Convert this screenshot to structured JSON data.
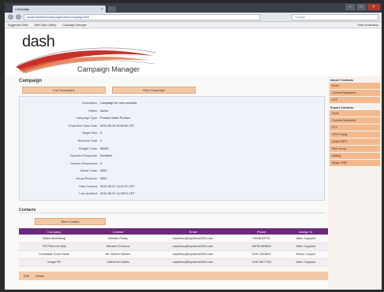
{
  "browser": {
    "tab_title": "Campaign",
    "url": "localhost/dash/campaign/view/campaign/id/4",
    "search_placeholder": "Google",
    "bookmarks": [
      "Suggested Sites",
      "Web Slice Gallery",
      "Campaign Manager"
    ],
    "other_bookmarks": "Other bookmarks"
  },
  "header": {
    "logo_word": "dash",
    "app_title": "Campaign Manager"
  },
  "page": {
    "title": "Campaign",
    "buttons": {
      "list": "List Campaigns",
      "view": "View Campaign"
    },
    "details": [
      {
        "label": "Description:",
        "value": "Campaign for new products"
      },
      {
        "label": "Status:",
        "value": "Active"
      },
      {
        "label": "Campaign Type:",
        "value": "Product Sales Product"
      },
      {
        "label": "Expected Close Date:",
        "value": "2012-05-15 00:00:00 CET"
      },
      {
        "label": "Target Size:",
        "value": "0"
      },
      {
        "label": "Revenue Goal:",
        "value": "0"
      },
      {
        "label": "Budget Costs:",
        "value": "50000"
      },
      {
        "label": "Expected Response:",
        "value": "Excellent"
      },
      {
        "label": "Number Responses:",
        "value": "0"
      },
      {
        "label": "Actual Costs:",
        "value": "5000"
      },
      {
        "label": "Actual Revenue:",
        "value": "5000"
      },
      {
        "label": "Date Created:",
        "value": "2012-05-07 14:21:07 CET"
      },
      {
        "label": "Last Updated:",
        "value": "2012-05-07 14:78:01 CET"
      }
    ]
  },
  "contacts": {
    "title": "Contacts",
    "new_button": "New Contact",
    "columns": [
      "Company",
      "Contact",
      "Email",
      "Phone",
      "Assign To"
    ],
    "rows": [
      [
        "Black advertising",
        "Woman Rosey",
        "sophieau@sophieus2020.com",
        "09048 83737",
        "Aben Cuppard"
      ],
      [
        "PE Plant Ltd Wall",
        "Michael O'Connor",
        "sophieau@sophieus2020.com",
        "08753 893664",
        "Aben Cuppard"
      ],
      [
        "Crowdstar Court Home",
        "Mr. Steven Warren",
        "sophieau@sophieus2020.com",
        "0131 2243897",
        "Simon Cooper"
      ],
      [
        "Image PE",
        "Catherine Hobes",
        "sophieau@sophieus2020.com",
        "0191 8677753",
        "Aben Cuppard"
      ]
    ],
    "footer_items": [
      "Edit",
      "Delete"
    ]
  },
  "sidebar": {
    "sections": [
      {
        "heading": "Import Contacts",
        "items": [
          "Excel",
          "Comma Separated",
          "VCF"
        ]
      },
      {
        "heading": "Export Contacts",
        "items": [
          "Excel",
          "Comma Separated",
          "VCF",
          "VRP Pricing",
          "Quick RSP1",
          "Web Group",
          "Mailing",
          "Single VRPI"
        ]
      }
    ]
  },
  "colors": {
    "accent_orange": "#f5c9a6",
    "table_header_purple": "#6b2a7a",
    "swoosh_red": "#c8312b"
  }
}
